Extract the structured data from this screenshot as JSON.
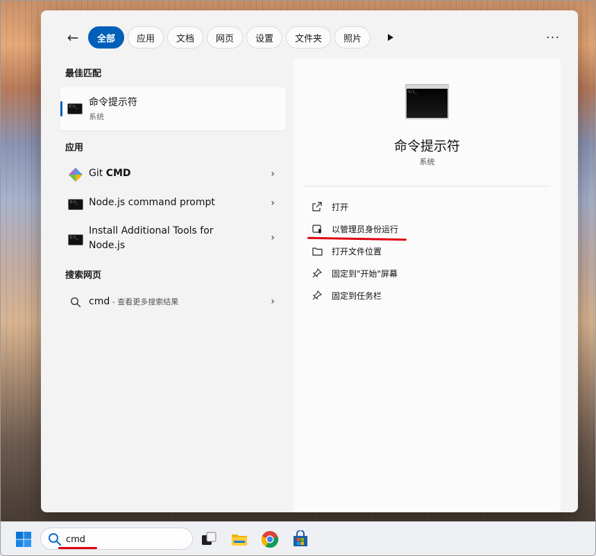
{
  "filters": {
    "back_label": "←",
    "tabs": [
      {
        "label": "全部",
        "active": true
      },
      {
        "label": "应用"
      },
      {
        "label": "文档"
      },
      {
        "label": "网页"
      },
      {
        "label": "设置"
      },
      {
        "label": "文件夹"
      },
      {
        "label": "照片"
      }
    ],
    "more_label": "···"
  },
  "best_match": {
    "section_title": "最佳匹配",
    "title": "命令提示符",
    "subtitle": "系统"
  },
  "apps": {
    "section_title": "应用",
    "items": [
      {
        "name_prefix": "Git ",
        "name_bold": "CMD",
        "icon": "git-icon"
      },
      {
        "name": "Node.js command prompt",
        "icon": "cmd-icon"
      },
      {
        "name_line1": "Install Additional Tools for",
        "name_line2": "Node.js",
        "icon": "cmd-icon"
      }
    ]
  },
  "web_search": {
    "section_title": "搜索网页",
    "query": "cmd",
    "suffix": " - 查看更多搜索结果"
  },
  "detail": {
    "title": "命令提示符",
    "subtitle": "系统",
    "actions": [
      {
        "label": "打开",
        "icon": "open-external-icon"
      },
      {
        "label": "以管理员身份运行",
        "icon": "admin-shield-icon"
      },
      {
        "label": "打开文件位置",
        "icon": "folder-icon"
      },
      {
        "label": "固定到\"开始\"屏幕",
        "icon": "pin-icon"
      },
      {
        "label": "固定到任务栏",
        "icon": "pin-icon"
      }
    ]
  },
  "taskbar": {
    "search_value": "cmd"
  },
  "colors": {
    "accent": "#005fb8",
    "highlight": "#e00010"
  }
}
